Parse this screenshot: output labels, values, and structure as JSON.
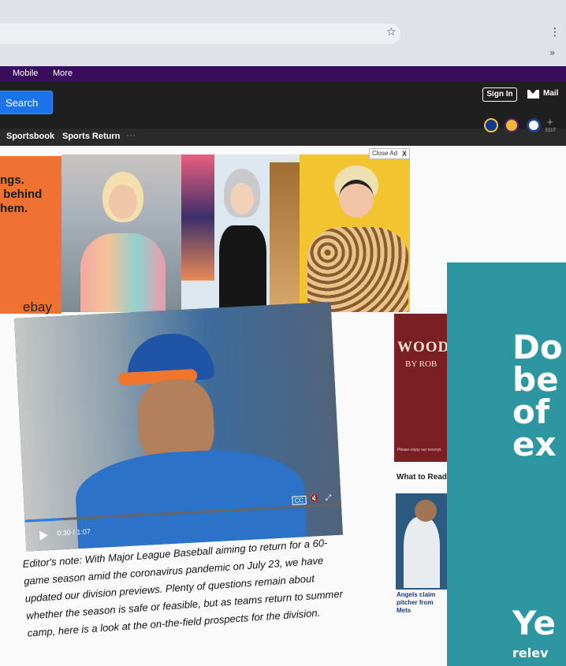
{
  "browser": {
    "star_icon": "star-icon",
    "menu_icon": "kebab-icon",
    "extensions_chevron": "»"
  },
  "topnav": {
    "items": [
      "Mobile",
      "More"
    ]
  },
  "header": {
    "search_label": "Search",
    "sign_in_label": "Sign In",
    "mail_label": "Mail"
  },
  "subnav": {
    "items": [
      "Sportsbook",
      "Sports Return"
    ],
    "more": "···",
    "edit_label": "EDIT"
  },
  "ad": {
    "text": "ngs.\n behind\nhem.",
    "brand": "ebay",
    "close_label": "Close Ad",
    "close_x": "X"
  },
  "video": {
    "time": "0:30 / 1:07",
    "progress": 0.12,
    "cc_label": "CC",
    "volume_icon": "volume-mute-icon",
    "fullscreen_icon": "expand-icon"
  },
  "article": {
    "editor_note": "Editor's note: With Major League Baseball aiming to return for a 60-game season amid the coronavirus pandemic on July 23, we have updated our division previews. Plenty of questions remain about whether the season is safe or feasible, but as teams return to summer camp, here is a look at the on-the-field prospects for the division."
  },
  "sidebar": {
    "book_title": "WOOD",
    "book_author": "BY ROB",
    "book_caption": "Please enjoy our excerpt",
    "section_title": "What to Read N",
    "story_caption": "Angels claim pitcher from Mets"
  },
  "overlay": {
    "headline": "Do\nbe\nof\nex",
    "second": "Ye",
    "sub": "relev"
  },
  "colors": {
    "purple_bar": "#3a0d5c",
    "search_blue": "#1a73e8",
    "ad_orange": "#f07232",
    "teal": "#2e96a0"
  }
}
